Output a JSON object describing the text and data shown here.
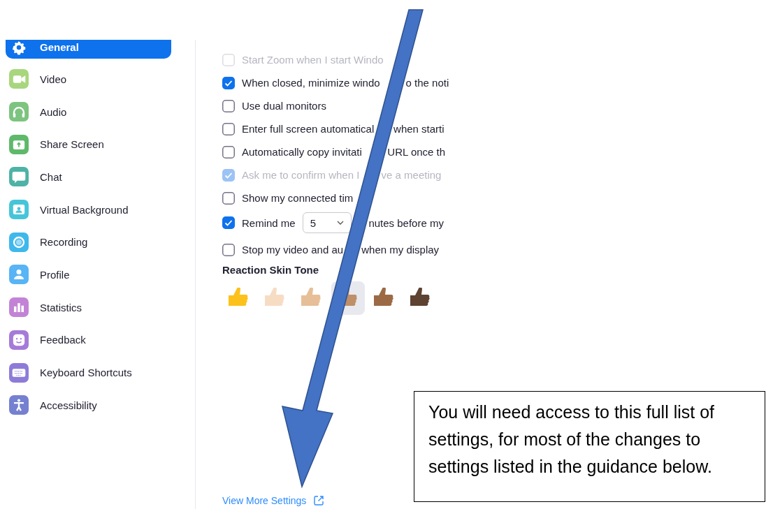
{
  "sidebar": {
    "items": [
      {
        "label": "General",
        "selected": true
      },
      {
        "label": "Video",
        "selected": false
      },
      {
        "label": "Audio",
        "selected": false
      },
      {
        "label": "Share Screen",
        "selected": false
      },
      {
        "label": "Chat",
        "selected": false
      },
      {
        "label": "Virtual Background",
        "selected": false
      },
      {
        "label": "Recording",
        "selected": false
      },
      {
        "label": "Profile",
        "selected": false
      },
      {
        "label": "Statistics",
        "selected": false
      },
      {
        "label": "Feedback",
        "selected": false
      },
      {
        "label": "Keyboard Shortcuts",
        "selected": false
      },
      {
        "label": "Accessibility",
        "selected": false
      }
    ]
  },
  "settings": [
    {
      "kind": "checkbox",
      "checked": false,
      "disabled": true,
      "text": "Start Zoom when I start Windo"
    },
    {
      "kind": "checkbox",
      "checked": true,
      "disabled": false,
      "text": "When closed, minimize windo",
      "text_after": "o the noti"
    },
    {
      "kind": "checkbox",
      "checked": false,
      "disabled": false,
      "text": "Use dual monitors"
    },
    {
      "kind": "checkbox",
      "checked": false,
      "disabled": false,
      "text": "Enter full screen automatical",
      "text_after": "when starti"
    },
    {
      "kind": "checkbox",
      "checked": false,
      "disabled": false,
      "text": "Automatically copy invitati",
      "text_after": "URL once th"
    },
    {
      "kind": "checkbox",
      "checked": true,
      "disabled": true,
      "text": "Ask me to confirm when I",
      "text_after": "ve a meeting"
    },
    {
      "kind": "checkbox",
      "checked": false,
      "disabled": false,
      "text": "Show my connected tim"
    },
    {
      "kind": "reminder",
      "checked": true,
      "disabled": false,
      "text": "Remind me",
      "value": "5",
      "text_after": "nutes before my"
    },
    {
      "kind": "checkbox",
      "checked": false,
      "disabled": false,
      "text": "Stop my video and au",
      "text_after": "when my display"
    }
  ],
  "reaction_skin_tone": {
    "title": "Reaction Skin Tone",
    "tones": [
      {
        "color": "#fcc21b",
        "selected": false
      },
      {
        "color": "#f7dcc4",
        "selected": false
      },
      {
        "color": "#e6bf98",
        "selected": false
      },
      {
        "color": "#bf8f68",
        "selected": true
      },
      {
        "color": "#9b6a45",
        "selected": false
      },
      {
        "color": "#5e4232",
        "selected": false
      }
    ]
  },
  "view_more_link": "View More Settings",
  "callout": {
    "text": "You will need access to this full list of settings, for most of the changes to settings listed in the guidance below."
  }
}
